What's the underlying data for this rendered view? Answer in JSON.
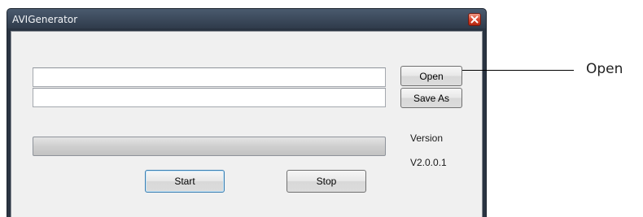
{
  "window": {
    "title": "AVIGenerator"
  },
  "inputs": {
    "source_path": {
      "value": "",
      "placeholder": ""
    },
    "output_path": {
      "value": "",
      "placeholder": ""
    }
  },
  "buttons": {
    "open_label": "Open",
    "save_as_label": "Save As",
    "start_label": "Start",
    "stop_label": "Stop"
  },
  "progress": {
    "value": 0
  },
  "version": {
    "label": "Version",
    "number": "V2.0.0.1"
  },
  "annotation": {
    "label": "Open"
  },
  "icons": {
    "close": "close-icon"
  },
  "colors": {
    "titlebar": "#2f3b4b",
    "client_background": "#f0f0f0",
    "close_button": "#d9452d",
    "default_button_border": "#3c7fb1"
  }
}
